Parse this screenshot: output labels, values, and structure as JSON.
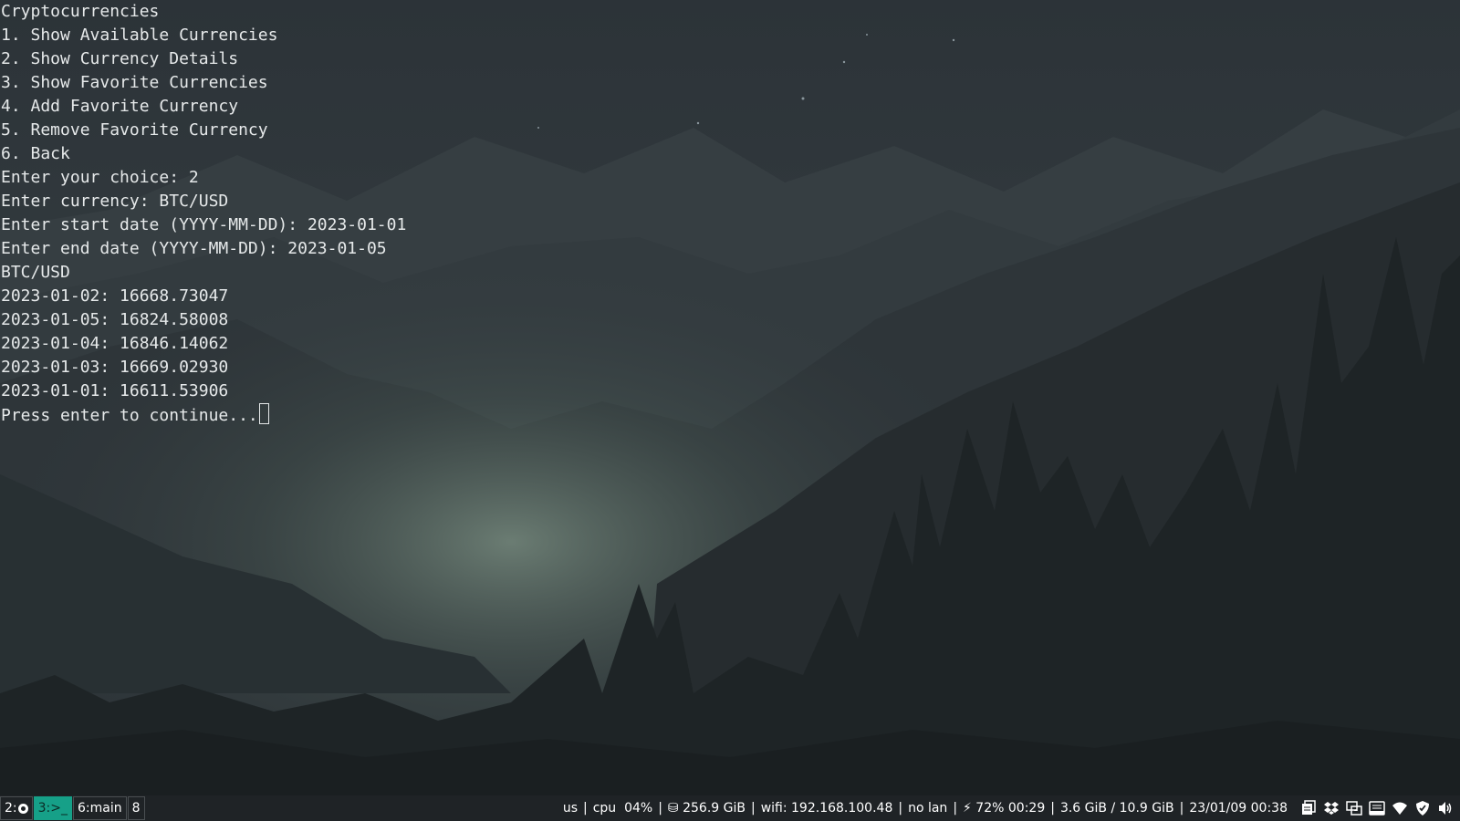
{
  "terminal": {
    "lines": [
      "Cryptocurrencies",
      "1. Show Available Currencies",
      "2. Show Currency Details",
      "3. Show Favorite Currencies",
      "4. Add Favorite Currency",
      "5. Remove Favorite Currency",
      "6. Back",
      "Enter your choice: 2",
      "Enter currency: BTC/USD",
      "Enter start date (YYYY-MM-DD): 2023-01-01",
      "Enter end date (YYYY-MM-DD): 2023-01-05",
      "BTC/USD",
      "2023-01-02: 16668.73047",
      "2023-01-05: 16824.58008",
      "2023-01-04: 16846.14062",
      "2023-01-03: 16669.02930",
      "2023-01-01: 16611.53906",
      "Press enter to continue..."
    ]
  },
  "statusbar": {
    "workspaces": [
      {
        "label": "2:",
        "icon": "globe-icon",
        "active": false
      },
      {
        "label": "3:>_",
        "active": true
      },
      {
        "label": "6:main",
        "active": false
      },
      {
        "label": "8",
        "active": false
      }
    ],
    "keyboard": "us",
    "cpu": "cpu  04%",
    "disk": "⛁ 256.9 GiB",
    "wifi": "wifi: 192.168.100.48",
    "lan": "no lan",
    "battery": "⚡ 72% 00:29",
    "memory": "3.6 GiB / 10.9 GiB",
    "datetime": "23/01/09 00:38",
    "separator": "|",
    "tray_icons": [
      "clipboard-icon",
      "dropbox-icon",
      "screen-share-icon",
      "mail-icon",
      "wifi-signal-icon",
      "shield-icon",
      "volume-icon"
    ]
  },
  "colors": {
    "terminal_text": "#e6e9ea",
    "statusbar_bg": "#1f2326",
    "active_workspace": "#16a088"
  }
}
